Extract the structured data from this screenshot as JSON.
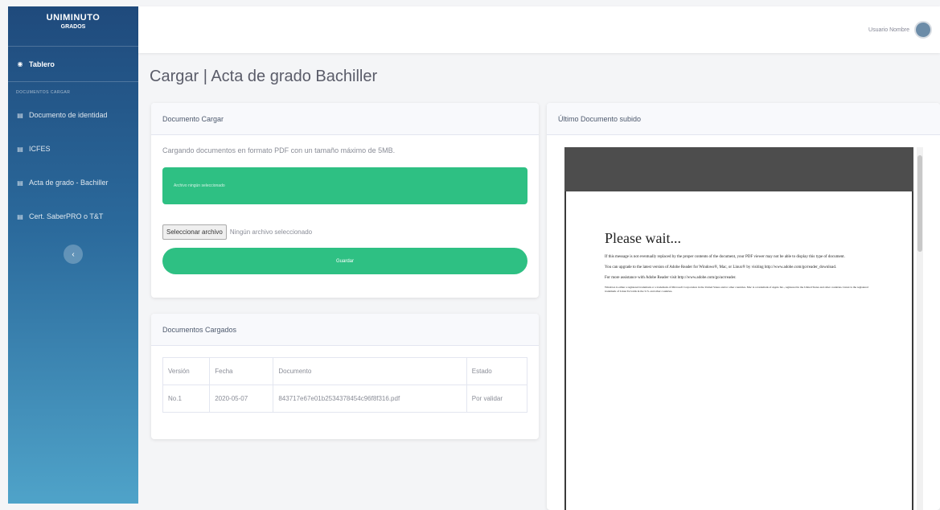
{
  "sidebar": {
    "brand_title": "UNIMINUTO",
    "brand_sub": "GRADOS",
    "dashboard": {
      "label": "Tablero",
      "icon": "dashboard-icon"
    },
    "section_heading": "Documentos cargar",
    "items": [
      {
        "label": "Documento de identidad",
        "icon": "file-icon"
      },
      {
        "label": "ICFES",
        "icon": "file-icon"
      },
      {
        "label": "Acta de grado - Bachiller",
        "icon": "file-icon"
      },
      {
        "label": "Cert. SaberPRO o T&T",
        "icon": "file-icon"
      }
    ],
    "toggle_icon": "chevron-left-icon"
  },
  "topbar": {
    "user_name": "Usuario Nombre"
  },
  "page_title": "Cargar | Acta de grado Bachiller",
  "upload_card": {
    "header": "Documento Cargar",
    "description": "Cargando documentos en formato PDF con un tamaño máximo de 5MB.",
    "alert_text": "Archivo ningún seleccionado",
    "file_button": "Seleccionar archivo",
    "file_status": "Ningún archivo seleccionado",
    "submit_label": "Guardar"
  },
  "docs_card": {
    "header": "Documentos Cargados",
    "columns": [
      "Versión",
      "Fecha",
      "Documento",
      "Estado"
    ],
    "rows": [
      [
        "No.1",
        "2020-05-07",
        "843717e67e01b2534378454c96f8f316.pdf",
        "Por validar"
      ]
    ]
  },
  "last_doc_card": {
    "header": "Último Documento subido",
    "viewer": {
      "title": "Please wait...",
      "p1": "If this message is not eventually replaced by the proper contents of the document, your PDF viewer may not be able to display this type of document.",
      "p2": "You can upgrade to the latest version of Adobe Reader for Windows®, Mac, or Linux® by visiting http://www.adobe.com/go/reader_download.",
      "p3": "For more assistance with Adobe Reader visit http://www.adobe.com/go/acrreader.",
      "p4": "Windows is either a registered trademark or a trademark of Microsoft Corporation in the United States and/or other countries. Mac is a trademark of Apple Inc., registered in the United States and other countries. Linux is the registered trademark of Linus Torvalds in the U.S. and other countries."
    }
  }
}
